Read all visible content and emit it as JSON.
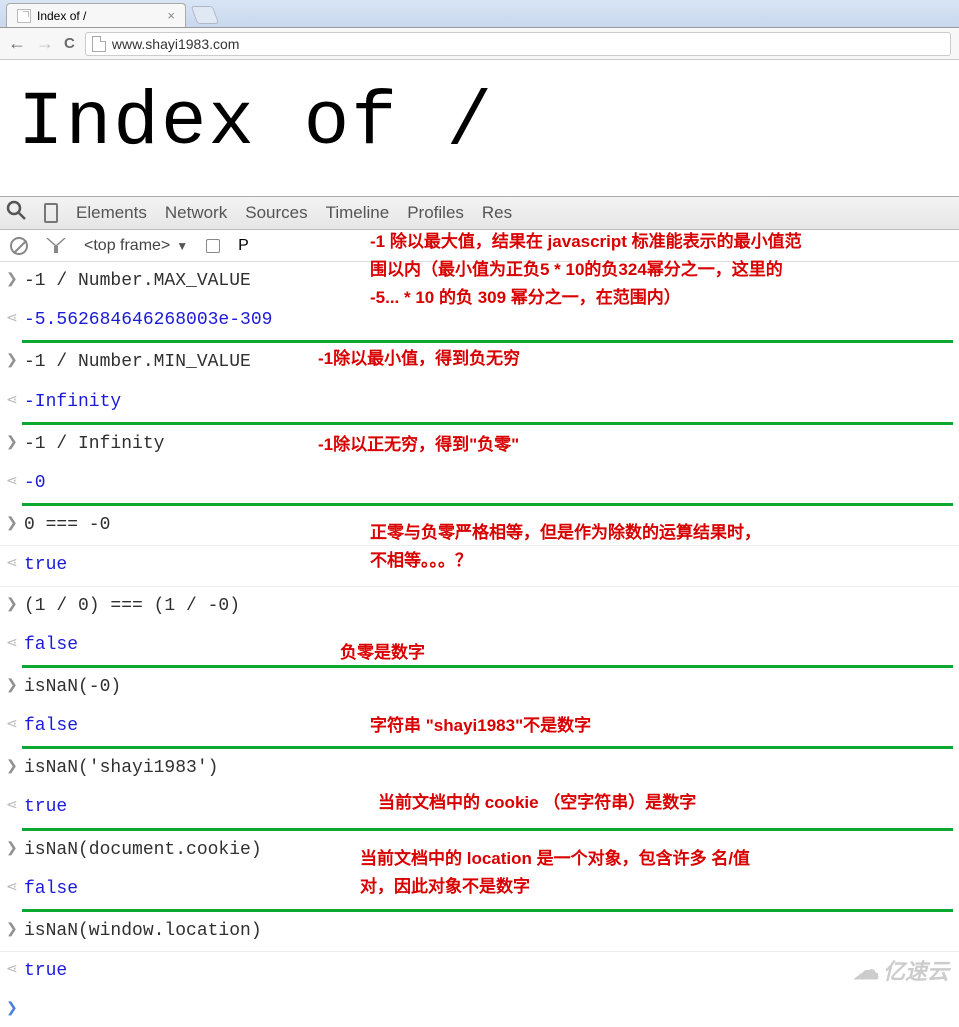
{
  "browser": {
    "tab_title": "Index of /",
    "url": "www.shayi1983.com"
  },
  "page": {
    "heading": "Index of /"
  },
  "devtools": {
    "tabs": [
      "Elements",
      "Network",
      "Sources",
      "Timeline",
      "Profiles",
      "Res"
    ],
    "frame_label": "<top frame>",
    "toolbar_p": "P"
  },
  "console_entries": [
    {
      "in": "-1 / Number.MAX_VALUE",
      "out": "-5.562684646268003e-309",
      "out_class": "result-num"
    },
    {
      "in": "-1 / Number.MIN_VALUE",
      "out": "-Infinity",
      "out_class": "result-num"
    },
    {
      "in": "-1 / Infinity",
      "out": "-0",
      "out_class": "result-num"
    },
    {
      "in": "0 === -0",
      "out": "true",
      "out_class": "result-kw"
    },
    {
      "in": "(1 / 0) === (1 / -0)",
      "out": "false",
      "out_class": "result-kw"
    },
    {
      "in": "isNaN(-0)",
      "out": "false",
      "out_class": "result-kw"
    },
    {
      "in": "isNaN('shayi1983')",
      "out": "true",
      "out_class": "result-kw"
    },
    {
      "in": "isNaN(document.cookie)",
      "out": "false",
      "out_class": "result-kw"
    },
    {
      "in": "isNaN(window.location)",
      "out": "true",
      "out_class": "result-kw"
    }
  ],
  "annotations": {
    "n1a": "-1 除以最大值，结果在 javascript 标准能表示的最小值范",
    "n1b": "围以内（最小值为正负5 * 10的负324幂分之一，这里的",
    "n1c": " -5... * 10 的负 309 幂分之一，在范围内）",
    "n2": "-1除以最小值，得到负无穷",
    "n3": "-1除以正无穷，得到\"负零\"",
    "n4a": "正零与负零严格相等，但是作为除数的运算结果时，",
    "n4b": "不相等。。。？",
    "n5": "负零是数字",
    "n6": "字符串 \"shayi1983\"不是数字",
    "n7": "当前文档中的 cookie （空字符串）是数字",
    "n8a": "当前文档中的 location 是一个对象，包含许多 名/值",
    "n8b": "对，因此对象不是数字"
  },
  "watermark": "亿速云"
}
